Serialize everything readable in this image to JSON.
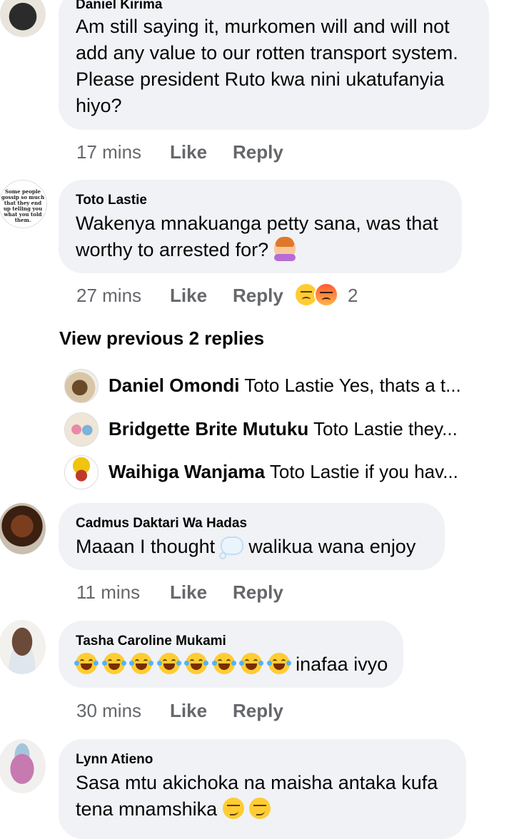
{
  "comments": [
    {
      "author": "Daniel Kirima",
      "text": "Am still saying it, murkomen will and will not add any value to our rotten transport system. Please president Ruto kwa nini ukatufanyia hiyo?",
      "time": "17 mins",
      "like": "Like",
      "reply": "Reply"
    },
    {
      "author": "Toto Lastie",
      "text": "Wakenya mnakuanga petty sana, was that worthy to arrested for?",
      "avatar_text": "Some people gossip so much that they end up telling you what you told them.",
      "time": "27 mins",
      "like": "Like",
      "reply": "Reply",
      "reaction_count": "2",
      "reactions": [
        "sad-icon",
        "angry-icon"
      ],
      "view_previous": "View previous 2 replies",
      "replies": [
        {
          "name": "Daniel Omondi",
          "text": "Toto Lastie Yes, thats a t..."
        },
        {
          "name": "Bridgette Brite Mutuku",
          "text": "Toto Lastie  they..."
        },
        {
          "name": "Waihiga Wanjama",
          "text": "Toto Lastie if you hav..."
        }
      ]
    },
    {
      "author": "Cadmus Daktari Wa Hadas",
      "text_before": "Maaan I thought",
      "text_after": "walikua wana enjoy",
      "time": "11 mins",
      "like": "Like",
      "reply": "Reply"
    },
    {
      "author": "Tasha Caroline Mukami",
      "text": "inafaa ivyo",
      "emoji_count": 8,
      "time": "30 mins",
      "like": "Like",
      "reply": "Reply"
    },
    {
      "author": "Lynn Atieno",
      "text_line1": "Sasa mtu akichoka na maisha antaka kufa",
      "text_line2": "tena mnamshika"
    }
  ],
  "colors": {
    "bubble": "#f0f2f5",
    "meta": "#65676b",
    "text": "#050505"
  }
}
